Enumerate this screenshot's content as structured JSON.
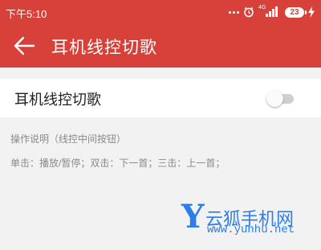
{
  "status_bar": {
    "time": "下午5:10",
    "network_label": "4G",
    "battery_level": "23",
    "icons": [
      "more-dots-icon",
      "alarm-icon",
      "signal-icon",
      "battery-icon",
      "charging-icon"
    ]
  },
  "toolbar": {
    "title": "耳机线控切歌",
    "back_icon": "arrow-left-icon"
  },
  "setting": {
    "label": "耳机线控切歌",
    "enabled": false
  },
  "help": {
    "heading": "操作说明（线控中间按钮）",
    "body": "单击：播放/暂停；双击：下一首；三击：上一首；"
  },
  "watermark": {
    "logo_letter": "Y",
    "name": "云狐手机网",
    "url": "www.yunhu.net"
  },
  "colors": {
    "accent": "#d7413a",
    "background": "#f2f2f2",
    "watermark": "#2b7de9"
  }
}
